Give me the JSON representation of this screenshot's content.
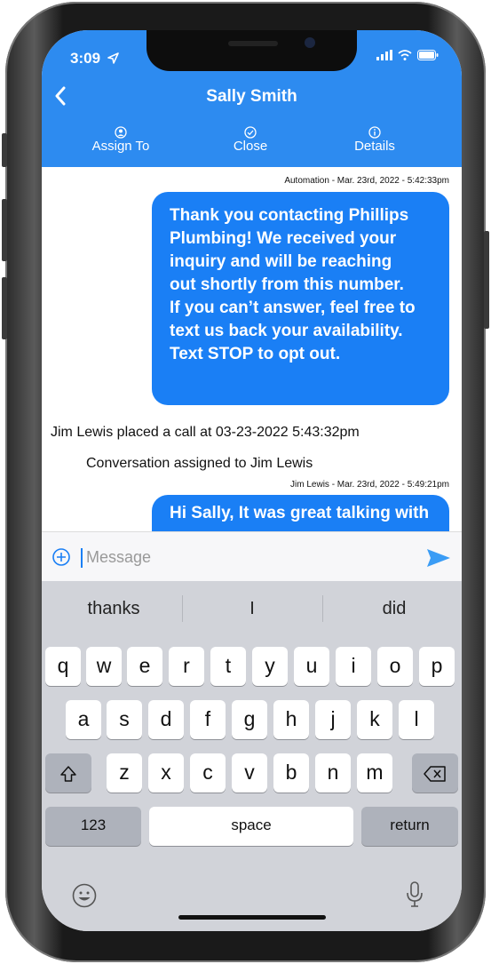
{
  "status": {
    "time": "3:09"
  },
  "header": {
    "title": "Sally Smith",
    "actions": [
      {
        "label": "Assign To",
        "icon": "person-circle-icon"
      },
      {
        "label": "Close",
        "icon": "check-circle-icon"
      },
      {
        "label": "Details",
        "icon": "info-circle-icon"
      }
    ]
  },
  "messages": {
    "m1_meta": "Automation - Mar. 23rd, 2022 - 5:42:33pm",
    "m1_lines": [
      "Thank you contacting Phillips",
      "Plumbing! We received your",
      "inquiry and will be reaching",
      "out shortly from this number.",
      "If you can’t answer, feel free to",
      "text us back your availability.",
      "Text STOP to opt out."
    ],
    "event_call": "Jim Lewis placed a call at 03-23-2022 5:43:32pm",
    "event_assign": "Conversation assigned to Jim Lewis",
    "m2_meta": "Jim Lewis - Mar. 23rd, 2022 - 5:49:21pm",
    "m2_line": "Hi Sally, It was great talking with"
  },
  "composer": {
    "placeholder": "Message"
  },
  "keyboard": {
    "suggestions": [
      "thanks",
      "I",
      "did"
    ],
    "row1": [
      "q",
      "w",
      "e",
      "r",
      "t",
      "y",
      "u",
      "i",
      "o",
      "p"
    ],
    "row2": [
      "a",
      "s",
      "d",
      "f",
      "g",
      "h",
      "j",
      "k",
      "l"
    ],
    "row3": [
      "z",
      "x",
      "c",
      "v",
      "b",
      "n",
      "m"
    ],
    "numbers": "123",
    "space": "space",
    "return": "return"
  },
  "colors": {
    "accent": "#2d8bf0",
    "bubble": "#1a7ff5"
  }
}
